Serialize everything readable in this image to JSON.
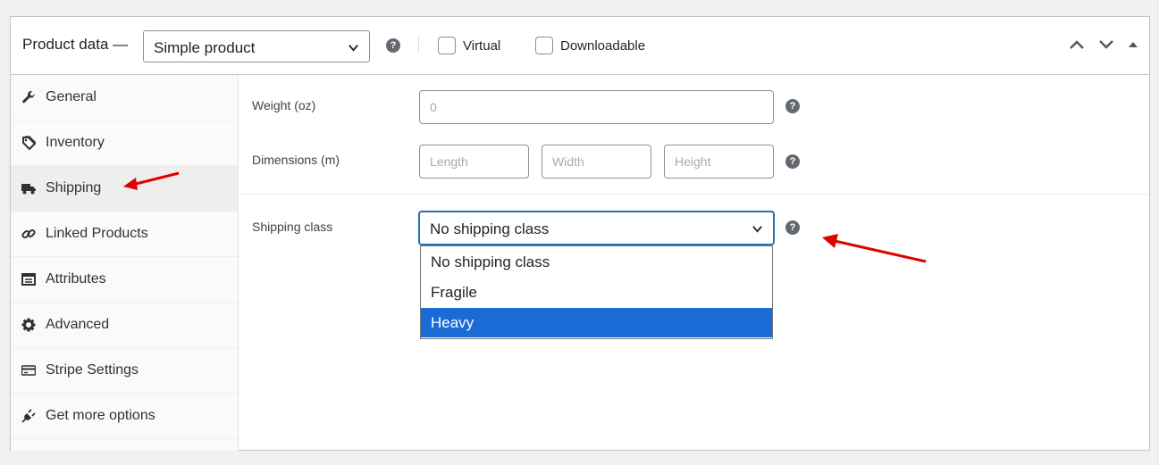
{
  "header": {
    "title": "Product data —",
    "product_type": "Simple product",
    "virtual_label": "Virtual",
    "downloadable_label": "Downloadable",
    "virtual_checked": false,
    "downloadable_checked": false
  },
  "sidebar": {
    "items": [
      {
        "label": "General",
        "icon": "wrench-icon"
      },
      {
        "label": "Inventory",
        "icon": "tag-icon"
      },
      {
        "label": "Shipping",
        "icon": "truck-icon",
        "active": true
      },
      {
        "label": "Linked Products",
        "icon": "link-icon"
      },
      {
        "label": "Attributes",
        "icon": "table-icon"
      },
      {
        "label": "Advanced",
        "icon": "gear-icon"
      },
      {
        "label": "Stripe Settings",
        "icon": "card-icon"
      },
      {
        "label": "Get more options",
        "icon": "plug-icon"
      }
    ]
  },
  "shipping": {
    "weight_label": "Weight (oz)",
    "weight_placeholder": "0",
    "dimensions_label": "Dimensions (m)",
    "length_placeholder": "Length",
    "width_placeholder": "Width",
    "height_placeholder": "Height",
    "class_label": "Shipping class",
    "class_value": "No shipping class",
    "class_options": [
      "No shipping class",
      "Fragile",
      "Heavy"
    ],
    "highlighted_option": "Heavy"
  },
  "colors": {
    "accent": "#2271b1",
    "option_highlight": "#1a6bd6",
    "annotation_arrow": "#e00000"
  }
}
